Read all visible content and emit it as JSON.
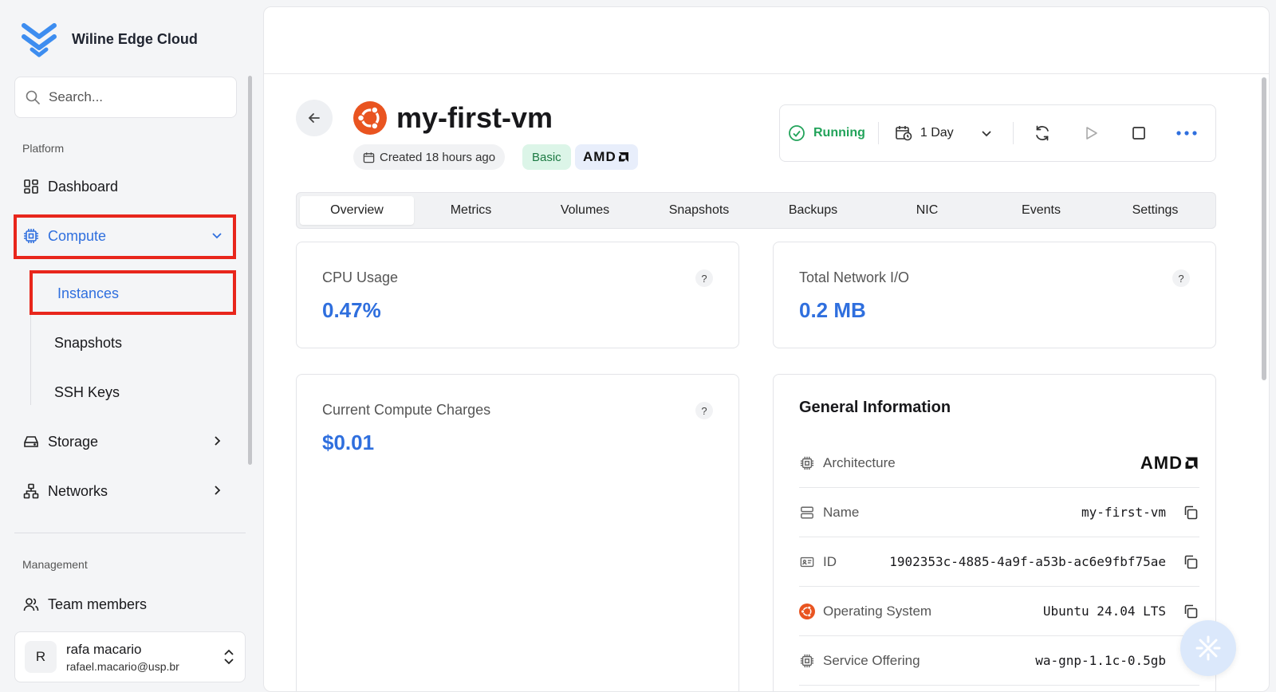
{
  "app": {
    "name": "Wiline Edge Cloud"
  },
  "sidebar": {
    "search_placeholder": "Search...",
    "section_platform": "Platform",
    "section_management": "Management",
    "items": {
      "dashboard": "Dashboard",
      "compute": "Compute",
      "instances": "Instances",
      "snapshots": "Snapshots",
      "ssh_keys": "SSH Keys",
      "storage": "Storage",
      "networks": "Networks",
      "team_members": "Team members"
    },
    "user": {
      "initial": "R",
      "name": "rafa macario",
      "email": "rafael.macario@usp.br"
    }
  },
  "instance": {
    "name": "my-first-vm",
    "created": "Created 18 hours ago",
    "plan_badge": "Basic",
    "arch_badge": "AMD",
    "status": "Running",
    "time_range": "1 Day"
  },
  "tabs": [
    "Overview",
    "Metrics",
    "Volumes",
    "Snapshots",
    "Backups",
    "NIC",
    "Events",
    "Settings"
  ],
  "metrics": {
    "cpu_label": "CPU Usage",
    "cpu_value": "0.47%",
    "net_label": "Total Network I/O",
    "net_value": "0.2 MB",
    "charges_label": "Current Compute Charges",
    "charges_value": "$0.01",
    "help": "?"
  },
  "general_info": {
    "title": "General Information",
    "rows": [
      {
        "label": "Architecture",
        "value": "AMD"
      },
      {
        "label": "Name",
        "value": "my-first-vm"
      },
      {
        "label": "ID",
        "value": "1902353c-4885-4a9f-a53b-ac6e9fbf75ae"
      },
      {
        "label": "Operating System",
        "value": "Ubuntu 24.04 LTS"
      },
      {
        "label": "Service Offering",
        "value": "wa-gnp-1.1c-0.5gb"
      }
    ]
  },
  "colors": {
    "accent": "#2f6fde",
    "running": "#22a35a",
    "ubuntu": "#e95420",
    "highlight": "#e8261c"
  }
}
